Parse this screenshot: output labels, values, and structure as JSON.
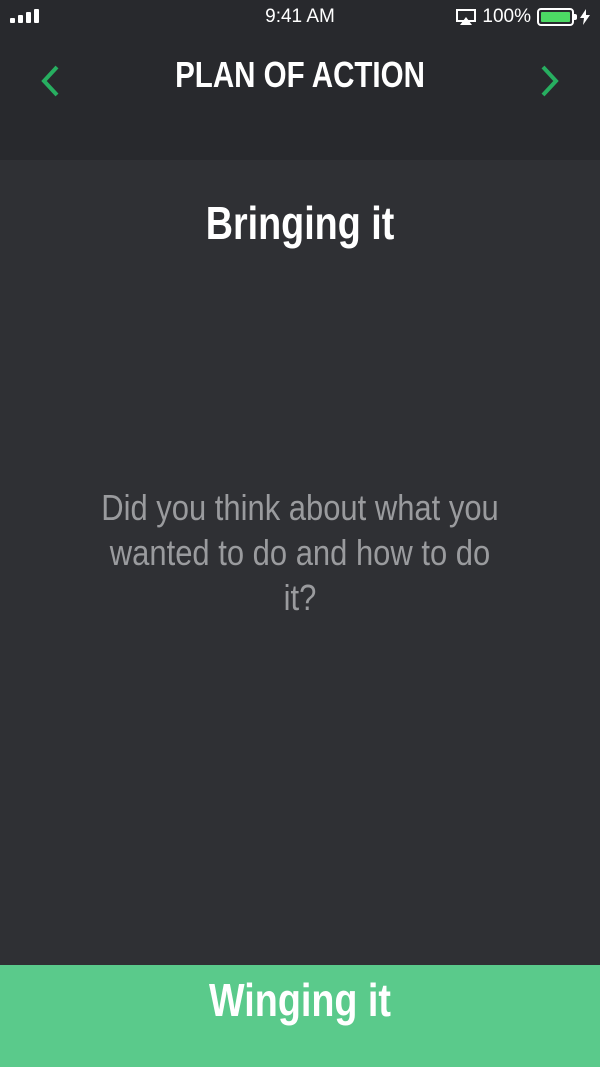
{
  "status_bar": {
    "time": "9:41 AM",
    "battery_percent": "100%",
    "battery_level": 1.0,
    "signal_icon": "cellular-signal-icon",
    "airplay_icon": "airplay-icon",
    "battery_icon": "battery-icon",
    "charging_icon": "charging-bolt-icon",
    "battery_color": "#4cd964"
  },
  "header": {
    "title": "PLAN OF ACTION",
    "back_icon": "chevron-left-icon",
    "next_icon": "chevron-right-icon",
    "arrow_color": "#27ae60"
  },
  "main": {
    "level_title": "Bringing it",
    "question": "Did you think about what you wanted to do and how to do it?"
  },
  "footer": {
    "button_label": "Winging it",
    "button_color": "#5aca8b"
  }
}
